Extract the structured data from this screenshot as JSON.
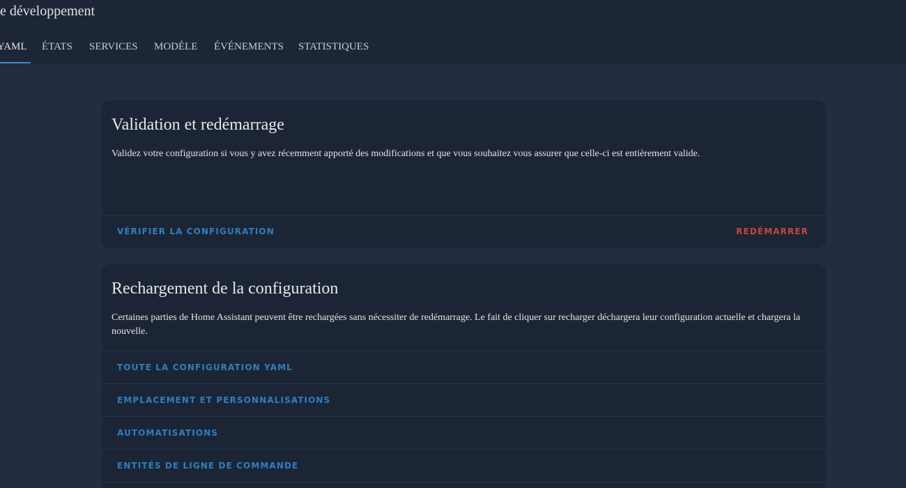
{
  "header": {
    "title": "e développement",
    "tabs": [
      {
        "label": "YAML",
        "active": true
      },
      {
        "label": "ÉTATS"
      },
      {
        "label": "SERVICES"
      },
      {
        "label": "MODÈLE"
      },
      {
        "label": "ÉVÉNEMENTS"
      },
      {
        "label": "STATISTIQUES"
      }
    ]
  },
  "validation_card": {
    "title": "Validation et redémarrage",
    "description": "Validez votre configuration si vous y avez récemment apporté des modifications et que vous souhaitez vous assurer que celle-ci est entièrement valide.",
    "check_button": "VÉRIFIER LA CONFIGURATION",
    "restart_button": "REDÉMARRER"
  },
  "reload_card": {
    "title": "Rechargement de la configuration",
    "description": "Certaines parties de Home Assistant peuvent être rechargées sans nécessiter de redémarrage. Le fait de cliquer sur recharger déchargera leur configuration actuelle et chargera la nouvelle.",
    "items": [
      {
        "label": "TOUTE LA CONFIGURATION YAML"
      },
      {
        "label": "EMPLACEMENT ET PERSONNALISATIONS"
      },
      {
        "label": "AUTOMATISATIONS"
      },
      {
        "label": "ENTITÉS DE LIGNE DE COMMANDE"
      }
    ]
  },
  "colors": {
    "background": "#222e40",
    "card": "#1c2535",
    "accent": "#2e7fc0",
    "danger": "#c6463e",
    "tab_indicator": "#3b8ed0"
  }
}
